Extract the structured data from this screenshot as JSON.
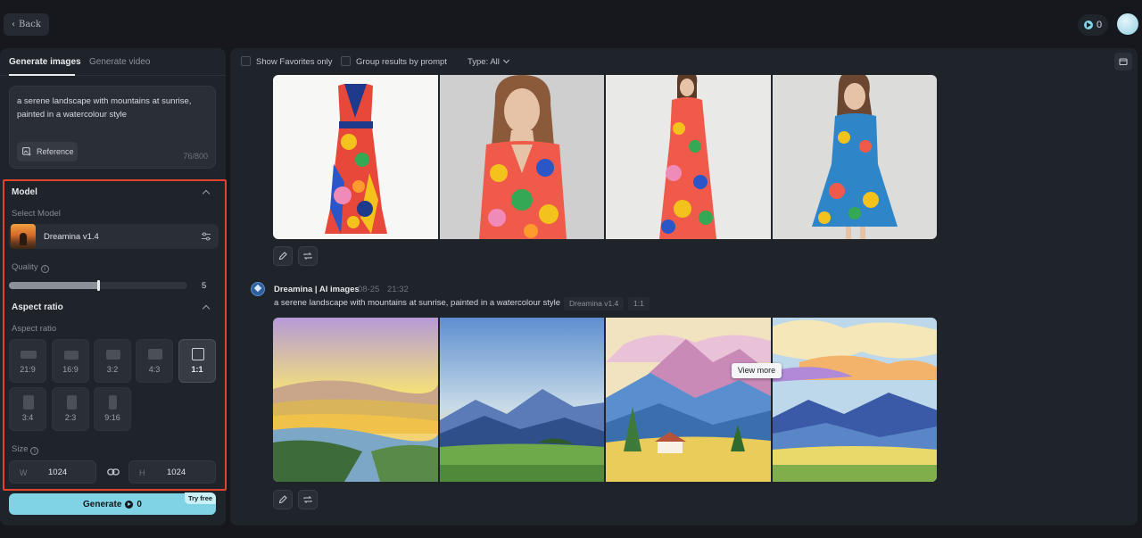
{
  "topbar": {
    "back_label": "Back",
    "credits": "0"
  },
  "tabs": [
    {
      "label": "Generate images",
      "active": true
    },
    {
      "label": "Generate video",
      "active": false
    }
  ],
  "prompt": {
    "text": "a serene landscape with mountains at sunrise, painted in a watercolour style",
    "reference_label": "Reference",
    "char_count": "76/800"
  },
  "model": {
    "section_title": "Model",
    "select_label": "Select Model",
    "selected_name": "Dreamina v1.4"
  },
  "quality": {
    "label": "Quality",
    "value": "5",
    "fraction": 0.5
  },
  "aspect": {
    "section_title": "Aspect ratio",
    "sub_label": "Aspect ratio",
    "options": [
      "21:9",
      "16:9",
      "3:2",
      "4:3",
      "1:1",
      "3:4",
      "2:3",
      "9:16"
    ],
    "selected": "1:1"
  },
  "size": {
    "label": "Size",
    "width_prefix": "W",
    "width": "1024",
    "height_prefix": "H",
    "height": "1024"
  },
  "generate": {
    "label": "Generate",
    "cost": "0",
    "badge": "Try free"
  },
  "filters": {
    "favorites": "Show Favorites only",
    "group": "Group results by prompt",
    "type": "Type: All"
  },
  "generation": {
    "source": "Dreamina | AI images",
    "date": "08-25",
    "time": "21:32",
    "prompt": "a serene landscape with mountains at sunrise, painted in a watercolour style",
    "model_chip": "Dreamina v1.4",
    "ratio_chip": "1:1",
    "view_more": "View more"
  },
  "colors": {
    "accent": "#7fd3e4",
    "highlight_border": "#e2442f",
    "panel": "#1f232a",
    "background": "#16181d"
  }
}
